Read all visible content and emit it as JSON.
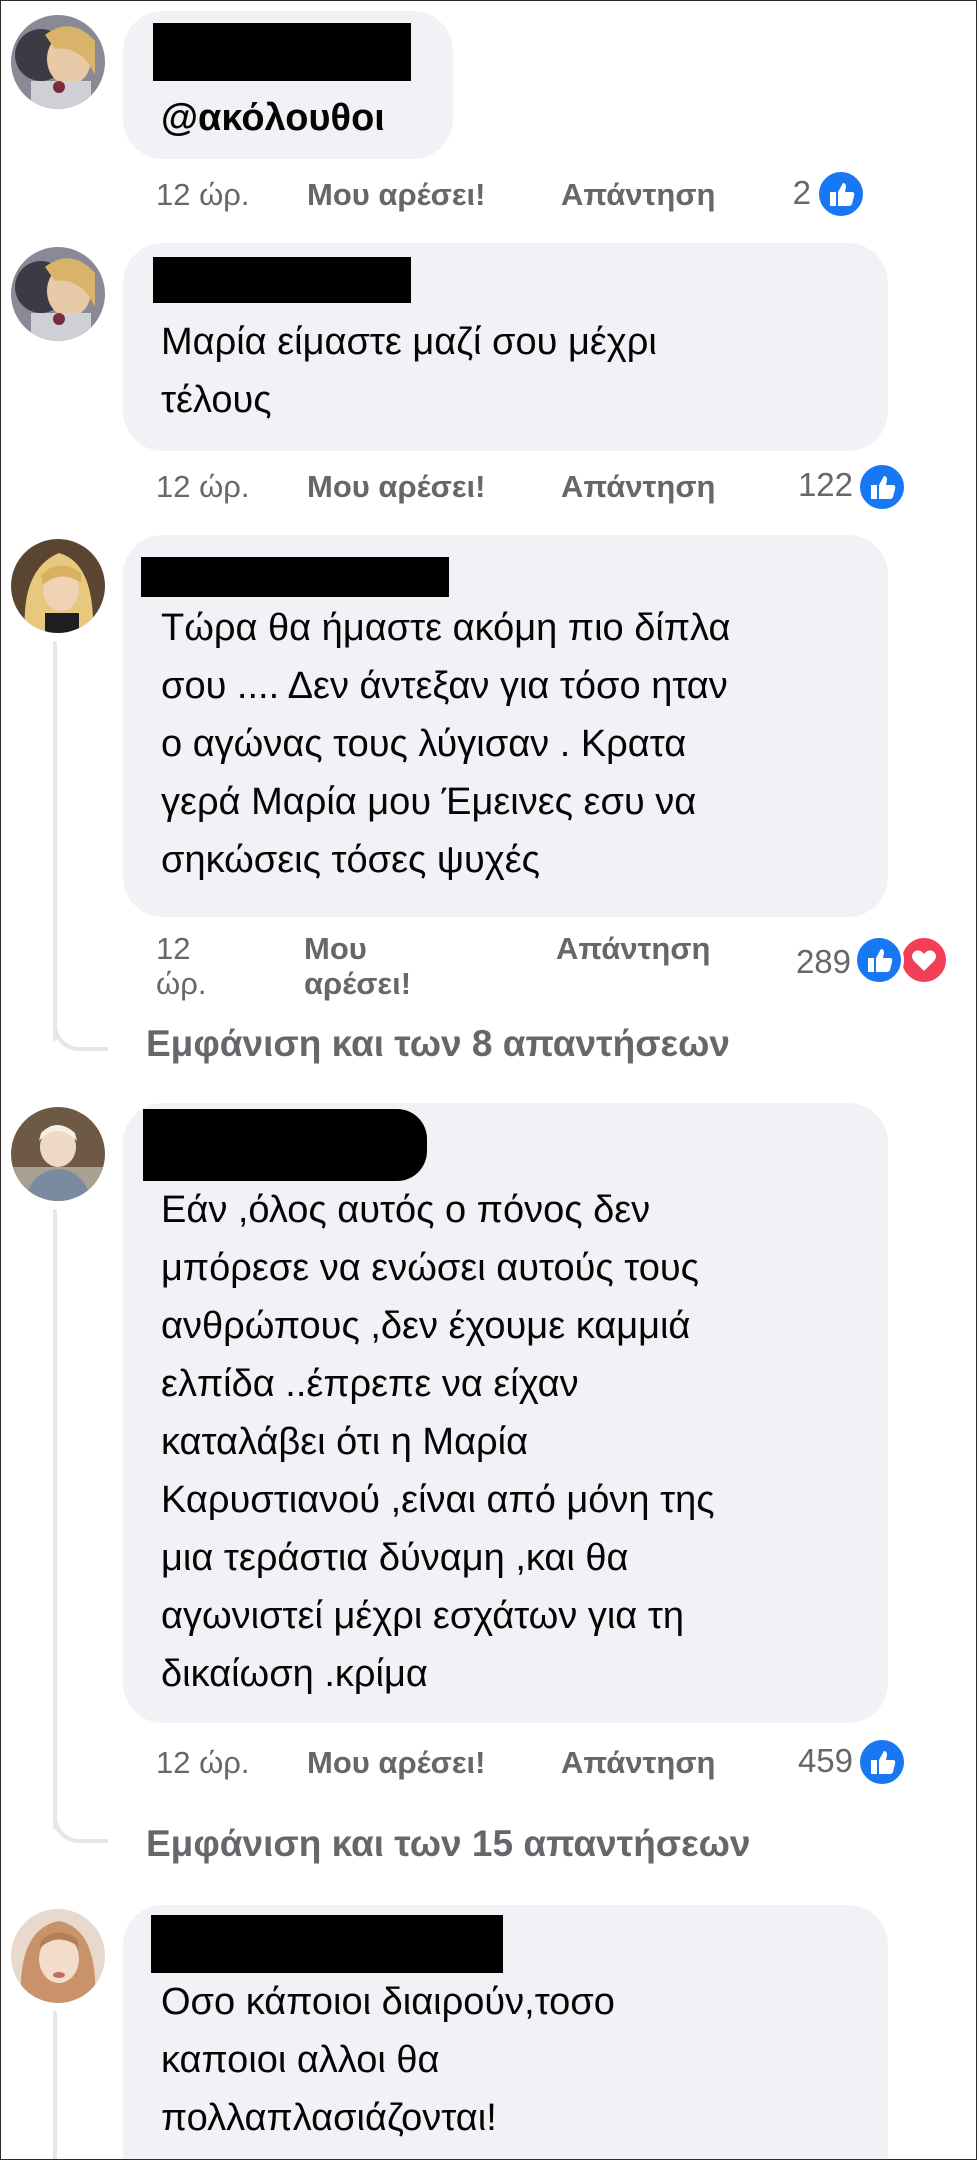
{
  "comments": [
    {
      "text": "@ακόλουθοι",
      "time": "12 ώρ.",
      "like": "Μου αρέσει!",
      "reply": "Απάντηση",
      "reactions": "2",
      "reaction_icons": [
        "like-icon"
      ]
    },
    {
      "text": "Μαρία είμαστε μαζί σου μέχρι\nτέλους",
      "time": "12 ώρ.",
      "like": "Μου αρέσει!",
      "reply": "Απάντηση",
      "reactions": "122",
      "reaction_icons": [
        "like-icon"
      ]
    },
    {
      "text": "Τώρα θα ήμαστε ακόμη πιο δίπλα\nσου .... Δεν άντεξαν για τόσο ηταν\nο αγώνας τους λύγισαν . Κρατα\nγερά Μαρία μου Έμεινες εσυ να\nσηκώσεις τόσες ψυχές",
      "time": "12\nώρ.",
      "like": "Μου\nαρέσει!",
      "reply": "Απάντηση",
      "reactions": "289",
      "reaction_icons": [
        "like-icon",
        "love-icon"
      ],
      "view_replies": "Εμφάνιση και των 8 απαντήσεων"
    },
    {
      "text": "Εάν ,όλος αυτός ο πόνος δεν\nμπόρεσε να ενώσει αυτούς τους\nανθρώπους ,δεν έχουμε καμμιά\nελπίδα ..έπρεπε να είχαν\nκαταλάβει ότι η Μαρία\nΚαρυστιανού ,είναι από μόνη της\nμια τεράστια δύναμη ,και θα\nαγωνιστεί μέχρι εσχάτων για τη\nδικαίωση .κρίμα",
      "time": "12 ώρ.",
      "like": "Μου αρέσει!",
      "reply": "Απάντηση",
      "reactions": "459",
      "reaction_icons": [
        "like-icon"
      ],
      "view_replies": "Εμφάνιση και των 15 απαντήσεων"
    },
    {
      "text": "Οσο κάποιοι διαιρούν,τοσο\nκαποιοι αλλοι θα\nπολλαπλασιάζονται!"
    }
  ],
  "colors": {
    "bubble": "#f0f2f5",
    "like": "#1877f2",
    "love": "#f33e58",
    "secondary_text": "#65676b",
    "thread_line": "#e4e6eb"
  }
}
